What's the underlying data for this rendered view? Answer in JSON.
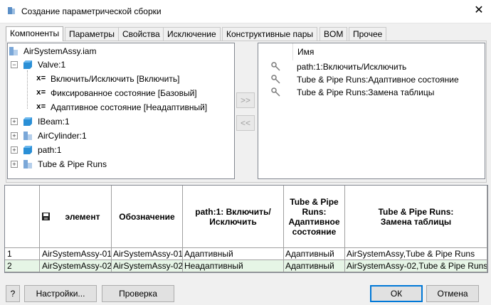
{
  "window": {
    "title": "Создание параметрической сборки",
    "close_glyph": "✕"
  },
  "tabs": [
    "Компоненты",
    "Параметры",
    "Свойства",
    "Исключение",
    "Конструктивные пары",
    "BOM",
    "Прочее"
  ],
  "tree": {
    "root": "AirSystemAssy.iam",
    "valve": "Valve:1",
    "x_prefix": "x=",
    "valve_children": [
      "Включить/Исключить [Включить]",
      "Фиксированное состояние [Базовый]",
      "Адаптивное состояние [Неадаптивный]"
    ],
    "others": [
      "IBeam:1",
      "AirCylinder:1",
      "path:1",
      "Tube & Pipe Runs"
    ]
  },
  "transfer": {
    "add": ">>",
    "remove": "<<"
  },
  "selected": {
    "header": "Имя",
    "items": [
      "path:1:Включить/Исключить",
      "Tube & Pipe Runs:Адаптивное состояние",
      "Tube & Pipe Runs:Замена таблицы"
    ]
  },
  "table": {
    "headers": {
      "element": "элемент",
      "designation": "Обозначение",
      "path": "path:1: Включить/Исключить",
      "adaptive": "Tube & Pipe Runs: Адаптивное состояние",
      "replace": "Tube & Pipe Runs: Замена таблицы"
    },
    "rows": [
      {
        "num": "1",
        "element": "AirSystemAssy-01",
        "designation": "AirSystemAssy-01",
        "path": "Адаптивный",
        "adaptive": "Адаптивный",
        "replace": "AirSystemAssy,Tube & Pipe Runs"
      },
      {
        "num": "2",
        "element": "AirSystemAssy-02",
        "designation": "AirSystemAssy-02",
        "path": "Неадаптивный",
        "adaptive": "Адаптивный",
        "replace": "AirSystemAssy-02,Tube & Pipe Runs"
      }
    ]
  },
  "buttons": {
    "help": "?",
    "settings": "Настройки...",
    "check": "Проверка",
    "ok": "ОК",
    "cancel": "Отмена"
  },
  "colors": {
    "selected_row": "#e6f5e6",
    "cube": "#2a8fd6"
  }
}
